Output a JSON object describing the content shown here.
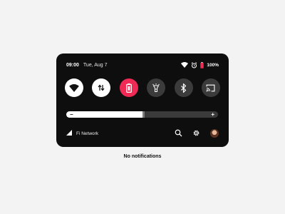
{
  "status_bar": {
    "time": "09:00",
    "date": "Tue, Aug 7",
    "battery_percent": "100%"
  },
  "quick_tiles": [
    {
      "name": "wifi",
      "icon": "wifi-icon",
      "active": true
    },
    {
      "name": "mobile-data",
      "icon": "data-arrows-icon",
      "active": true
    },
    {
      "name": "battery-saver",
      "icon": "battery-icon",
      "active": true
    },
    {
      "name": "flashlight",
      "icon": "flashlight-icon",
      "active": false
    },
    {
      "name": "bluetooth",
      "icon": "bluetooth-icon",
      "active": false
    },
    {
      "name": "cast",
      "icon": "cast-icon",
      "active": false
    }
  ],
  "brightness": {
    "level": 0.5,
    "minus_label": "−",
    "plus_label": "+"
  },
  "network": {
    "name": "Fi Network"
  },
  "notifications": {
    "empty_text": "No notifications"
  },
  "colors": {
    "panel_bg": "#0e0e0e",
    "accent_red": "#ee2a55",
    "tile_inactive": "#3b3b3b"
  }
}
